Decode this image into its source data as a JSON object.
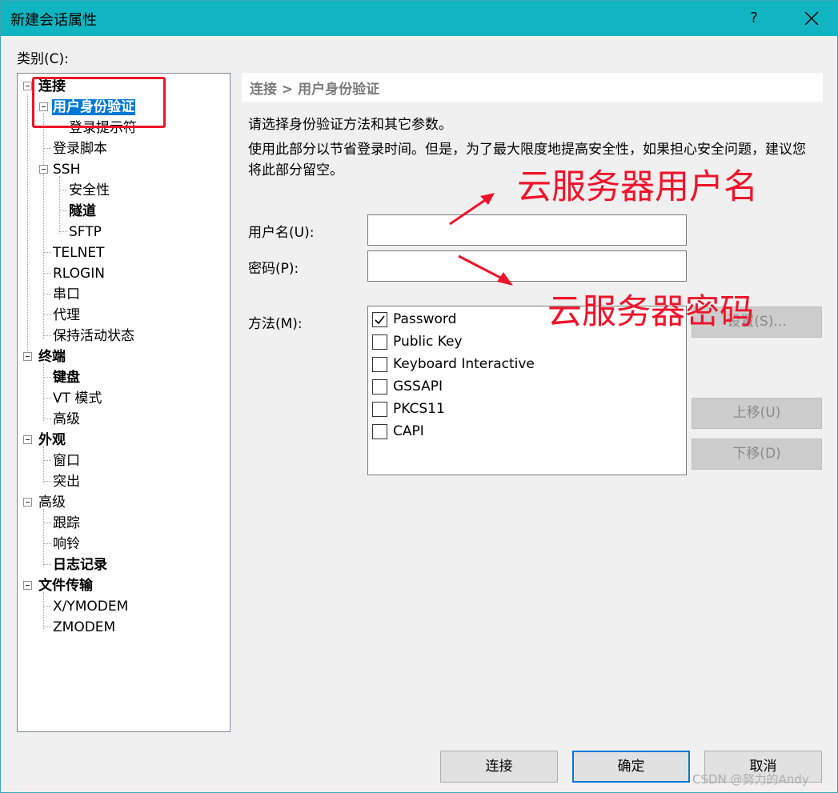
{
  "window": {
    "title": "新建会话属性",
    "help_label": "?"
  },
  "category_label": "类别(C):",
  "tree": {
    "items": [
      {
        "label": "连接"
      },
      {
        "label": "用户身份验证"
      },
      {
        "label": "登录提示符"
      },
      {
        "label": "登录脚本"
      },
      {
        "label": "SSH"
      },
      {
        "label": "安全性"
      },
      {
        "label": "隧道"
      },
      {
        "label": "SFTP"
      },
      {
        "label": "TELNET"
      },
      {
        "label": "RLOGIN"
      },
      {
        "label": "串口"
      },
      {
        "label": "代理"
      },
      {
        "label": "保持活动状态"
      },
      {
        "label": "终端"
      },
      {
        "label": "键盘"
      },
      {
        "label": "VT 模式"
      },
      {
        "label": "高级"
      },
      {
        "label": "外观"
      },
      {
        "label": "窗口"
      },
      {
        "label": "突出"
      },
      {
        "label": "高级"
      },
      {
        "label": "跟踪"
      },
      {
        "label": "响铃"
      },
      {
        "label": "日志记录"
      },
      {
        "label": "文件传输"
      },
      {
        "label": "X/YMODEM"
      },
      {
        "label": "ZMODEM"
      }
    ],
    "selected": "用户身份验证"
  },
  "panel": {
    "breadcrumb": "连接 > 用户身份验证",
    "description": "请选择身份验证方法和其它参数。",
    "note": "使用此部分以节省登录时间。但是，为了最大限度地提高安全性，如果担心安全问题，建议您将此部分留空。",
    "username_label": "用户名(U):",
    "username_value": "",
    "password_label": "密码(P):",
    "password_value": "",
    "method_label": "方法(M):",
    "methods": [
      {
        "label": "Password",
        "checked": true
      },
      {
        "label": "Public Key",
        "checked": false
      },
      {
        "label": "Keyboard Interactive",
        "checked": false
      },
      {
        "label": "GSSAPI",
        "checked": false
      },
      {
        "label": "PKCS11",
        "checked": false
      },
      {
        "label": "CAPI",
        "checked": false
      }
    ],
    "settings_button": "设置(S)...",
    "move_up_button": "上移(U)",
    "move_down_button": "下移(D)"
  },
  "buttons": {
    "connect": "连接",
    "ok": "确定",
    "cancel": "取消"
  },
  "annotations": {
    "username_note": "云服务器用户名",
    "password_note": "云服务器密码",
    "color": "#f0142a"
  },
  "watermark": "CSDN @努力的Andy",
  "colors": {
    "titlebar": "#10b5c1",
    "selection": "#0078d7"
  }
}
